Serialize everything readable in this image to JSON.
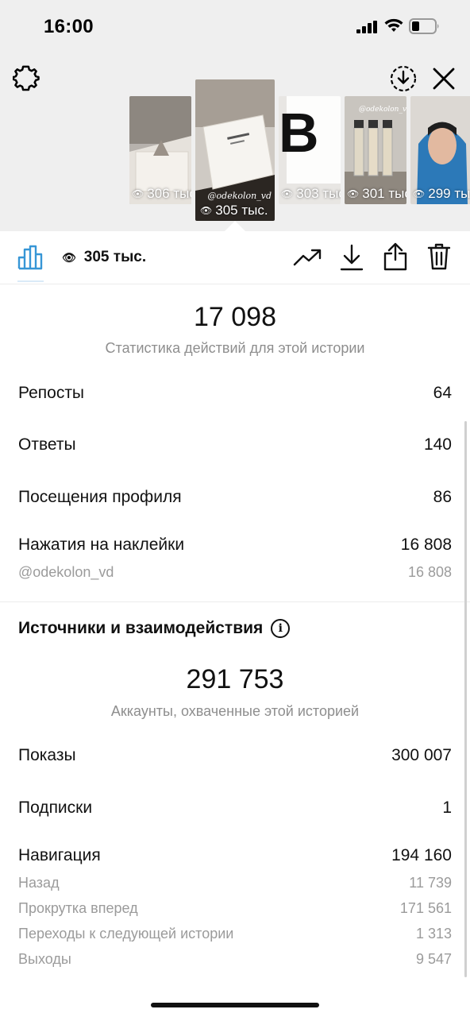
{
  "status_bar": {
    "time": "16:00"
  },
  "stories": [
    {
      "views": "306 тыс."
    },
    {
      "views": "305 тыс.",
      "selected": true,
      "caption": "@odekolon_vd"
    },
    {
      "views": "303 тыс."
    },
    {
      "views": "301 тыс.",
      "caption": "@odekolon_vd"
    },
    {
      "views": "299 тыс."
    }
  ],
  "toolbar": {
    "views": "305 тыс."
  },
  "interactions": {
    "total": "17 098",
    "caption": "Статистика действий для этой истории",
    "rows": [
      {
        "label": "Репосты",
        "value": "64"
      },
      {
        "label": "Ответы",
        "value": "140"
      },
      {
        "label": "Посещения профиля",
        "value": "86"
      },
      {
        "label": "Нажатия на наклейки",
        "value": "16 808"
      }
    ],
    "sub_rows": [
      {
        "label": "@odekolon_vd",
        "value": "16 808"
      }
    ]
  },
  "discovery": {
    "title": "Источники и взаимодействия",
    "total": "291 753",
    "caption": "Аккаунты, охваченные этой историей",
    "rows": [
      {
        "label": "Показы",
        "value": "300 007"
      },
      {
        "label": "Подписки",
        "value": "1"
      },
      {
        "label": "Навигация",
        "value": "194 160"
      }
    ],
    "nav_sub_rows": [
      {
        "label": "Назад",
        "value": "11 739"
      },
      {
        "label": "Прокрутка вперед",
        "value": "171 561"
      },
      {
        "label": "Переходы к следующей истории",
        "value": "1 313"
      },
      {
        "label": "Выходы",
        "value": "9 547"
      }
    ]
  },
  "icons": [
    "signal-icon",
    "wifi-icon",
    "battery-icon",
    "settings-gear-icon",
    "download-circle-icon",
    "close-icon",
    "bar-chart-icon",
    "eye-icon",
    "trending-up-icon",
    "download-icon",
    "share-icon",
    "trash-icon",
    "info-icon"
  ]
}
